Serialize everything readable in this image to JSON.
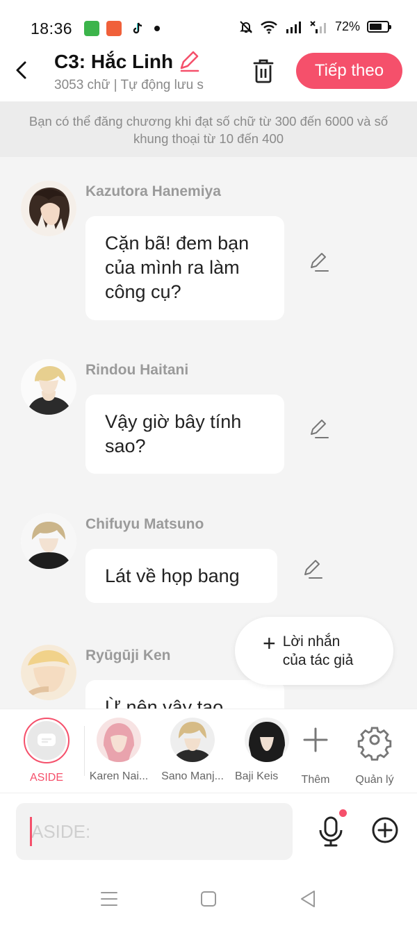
{
  "status": {
    "time": "18:36",
    "battery": "72%",
    "battery_level": 0.72
  },
  "header": {
    "title": "C3: Hắc Linh",
    "subtitle": "3053 chữ | Tự động lưu s",
    "next_label": "Tiếp theo"
  },
  "notice": "Bạn có thể đăng chương khi đạt số chữ từ 300 đến 6000 và số khung thoại từ 10 đến 400",
  "messages": [
    {
      "name": "Kazutora Hanemiya",
      "text_lines": [
        "Cặn bã! đem bạn",
        "của mình ra làm",
        "công cụ?"
      ]
    },
    {
      "name": "Rindou Haitani",
      "text_lines": [
        "Vậy giờ bây tính",
        "sao?"
      ]
    },
    {
      "name": "Chifuyu Matsuno",
      "text_lines": [
        "Lát về họp bang"
      ]
    },
    {
      "name": "Ryūgūji Ken",
      "text_lines": [
        "Ừ nên vậy tao"
      ]
    }
  ],
  "fab": {
    "label_line1": "Lời nhắn",
    "label_line2": "của tác giả"
  },
  "characters": [
    {
      "label": "ASIDE"
    },
    {
      "label": "Karen Nai..."
    },
    {
      "label": "Sano Manj..."
    },
    {
      "label": "Baji Keis"
    },
    {
      "label": "Thêm"
    },
    {
      "label": "Quản lý"
    }
  ],
  "input": {
    "placeholder": "ASIDE:"
  },
  "colors": {
    "accent": "#f5506b",
    "background": "#f4f4f4"
  },
  "icons": [
    "back-icon",
    "pencil-icon",
    "trash-icon",
    "edit-icon",
    "plus-icon",
    "settings-icon",
    "mic-icon",
    "add-circle-icon"
  ]
}
